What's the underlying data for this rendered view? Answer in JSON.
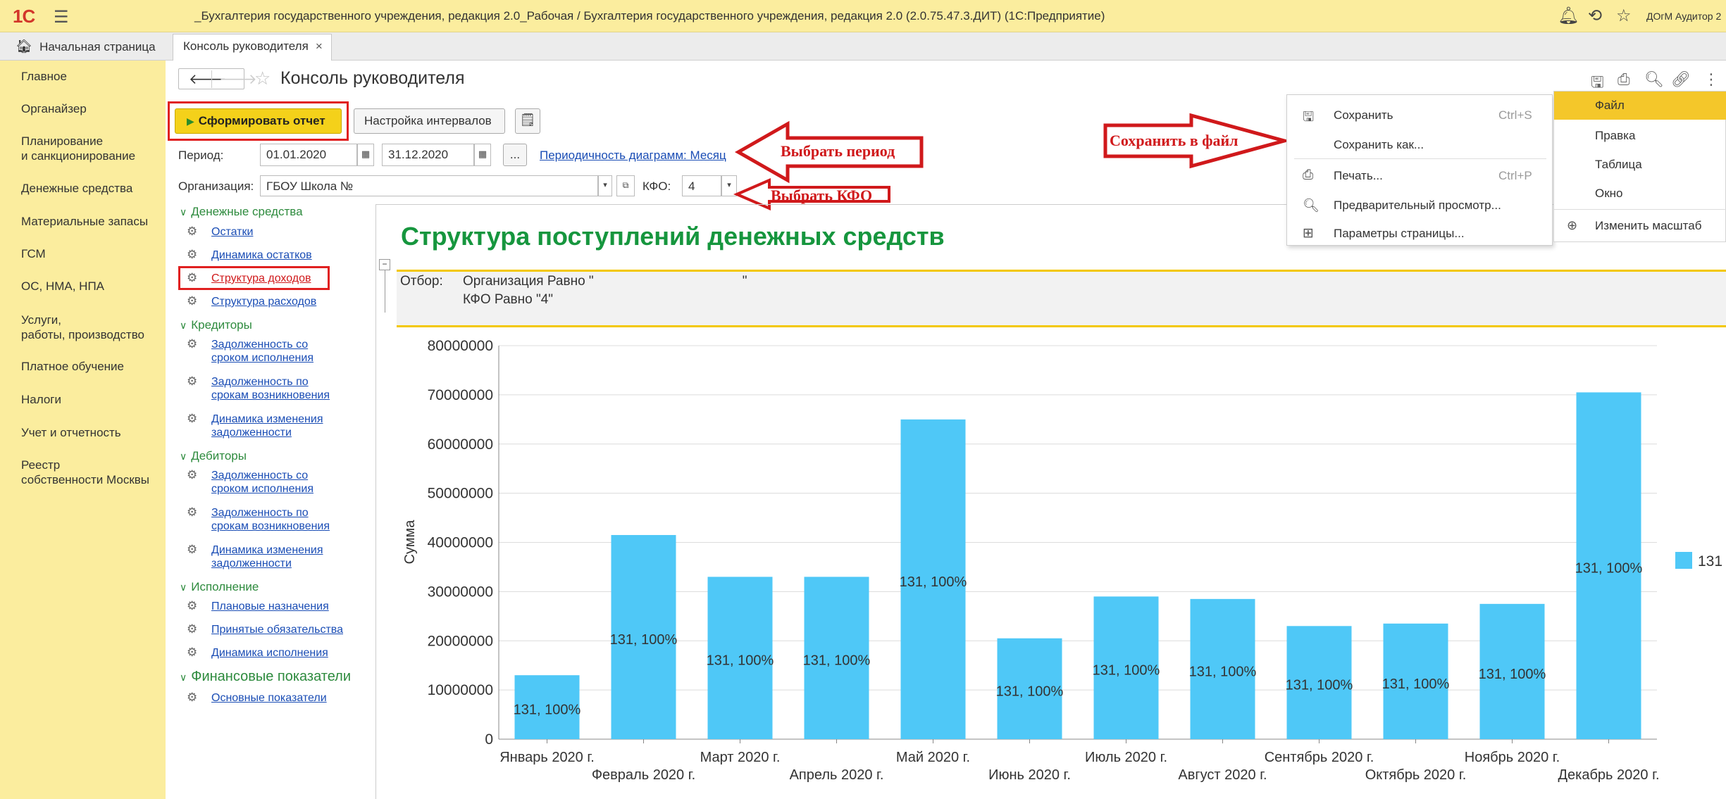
{
  "titlebar": {
    "logo": "1С",
    "menu_icon": "burger-icon",
    "app_title": "_Бухгалтерия государственного учреждения, редакция 2.0_Рабочая / Бухгалтерия государственного учреждения, редакция 2.0 (2.0.75.47.3.ДИТ)  (1С:Предприятие)",
    "user": "ДОгМ Аудитор 2",
    "icons": [
      "bell-icon",
      "history-icon",
      "star-icon"
    ]
  },
  "tabs": {
    "home": "Начальная страница",
    "active": "Консоль руководителя",
    "close": "×"
  },
  "sidebar": {
    "items": [
      {
        "label": "Главное"
      },
      {
        "label": "Органайзер"
      },
      {
        "label": "Планирование\nи санкционирование"
      },
      {
        "label": "Денежные средства"
      },
      {
        "label": "Материальные запасы"
      },
      {
        "label": "ГСМ"
      },
      {
        "label": "ОС, НМА, НПА"
      },
      {
        "label": "Услуги,\nработы, производство"
      },
      {
        "label": "Платное обучение"
      },
      {
        "label": "Налоги"
      },
      {
        "label": "Учет и отчетность"
      },
      {
        "label": "Реестр\nсобственности Москвы"
      }
    ]
  },
  "header": {
    "back": "🡐",
    "forward": "🡒",
    "title": "Консоль руководителя"
  },
  "toolbar": {
    "form_report": "Сформировать отчет",
    "intervals": "Настройка интервалов"
  },
  "params": {
    "period_label": "Период:",
    "date_from": "01.01.2020",
    "date_to": "31.12.2020",
    "dots": "...",
    "periodicity_link": "Периодичность диаграмм: Месяц",
    "org_label": "Организация:",
    "org_value": "ГБОУ Школа №",
    "kfo_label": "КФО:",
    "kfo_value": "4"
  },
  "annotations": {
    "choose_period": "Выбрать период",
    "choose_kfo": "Выбрать КФО",
    "save_to_file": "Сохранить в файл"
  },
  "tree": {
    "groups": [
      {
        "label": "Денежные средства",
        "items": [
          "Остатки",
          "Динамика остатков",
          "Структура доходов",
          "Структура расходов"
        ]
      },
      {
        "label": "Кредиторы",
        "items": [
          "Задолженность со\nсроком исполнения",
          "Задолженность по\nсрокам возникновения",
          "Динамика изменения\nзадолженности"
        ]
      },
      {
        "label": "Дебиторы",
        "items": [
          "Задолженность со\nсроком исполнения",
          "Задолженность по\nсрокам возникновения",
          "Динамика изменения\nзадолженности"
        ]
      },
      {
        "label": "Исполнение",
        "items": [
          "Плановые назначения",
          "Принятые обязательства",
          "Динамика исполнения"
        ]
      },
      {
        "label": "Финансовые показатели",
        "items": [
          "Основные показатели"
        ]
      }
    ]
  },
  "report": {
    "title": "Структура поступлений денежных средств",
    "filter_label": "Отбор:",
    "filter_line1": "Организация Равно \"                                        \"",
    "filter_line2": "КФО Равно \"4\""
  },
  "context_menu": {
    "items": [
      {
        "icon": "save-icon",
        "label": "Сохранить",
        "shortcut": "Ctrl+S"
      },
      {
        "icon": "",
        "label": "Сохранить как...",
        "shortcut": ""
      },
      {
        "icon": "print-icon",
        "label": "Печать...",
        "shortcut": "Ctrl+P"
      },
      {
        "icon": "preview-icon",
        "label": "Предварительный просмотр...",
        "shortcut": ""
      },
      {
        "icon": "page-setup-icon",
        "label": "Параметры страницы...",
        "shortcut": ""
      }
    ]
  },
  "side_menu": {
    "items": [
      "Файл",
      "Правка",
      "Таблица",
      "Окно",
      "Изменить масштаб"
    ]
  },
  "colors": {
    "sidebar": "#fbed9e",
    "accent": "#f4d11a",
    "bar": "#4fc8f7",
    "report_title": "#16963e",
    "annotation": "#d0191b"
  },
  "chart_data": {
    "type": "bar",
    "ylabel": "Сумма",
    "ylim": [
      0,
      80000000
    ],
    "yticks": [
      0,
      10000000,
      20000000,
      30000000,
      40000000,
      50000000,
      60000000,
      70000000,
      80000000
    ],
    "categories": [
      "Январь 2020 г.",
      "Февраль 2020 г.",
      "Март 2020 г.",
      "Апрель 2020 г.",
      "Май 2020 г.",
      "Июнь 2020 г.",
      "Июль 2020 г.",
      "Август 2020 г.",
      "Сентябрь 2020 г.",
      "Октябрь 2020 г.",
      "Ноябрь 2020 г.",
      "Декабрь 2020 г."
    ],
    "series": [
      {
        "name": "131",
        "values": [
          13000000,
          41500000,
          33000000,
          33000000,
          65000000,
          20500000,
          29000000,
          28500000,
          23000000,
          23500000,
          27500000,
          70500000
        ]
      }
    ],
    "data_label": "131, 100%",
    "legend": "right",
    "grid": true
  }
}
